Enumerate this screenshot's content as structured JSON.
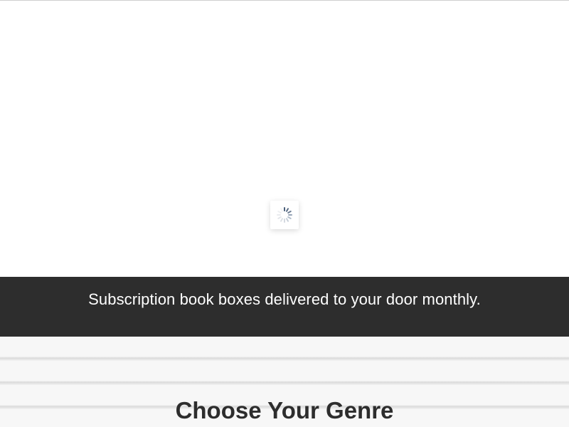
{
  "hero": {
    "loader_icon": "loading-spinner-icon"
  },
  "banner": {
    "tagline": "Subscription book boxes delivered to your door monthly."
  },
  "genre_section": {
    "title": "Choose Your Genre"
  },
  "colors": {
    "banner_background": "#2d2d2d",
    "banner_text": "#ffffff",
    "title_text": "#2d2d2d",
    "spinner_accent": "#4a5f7a"
  }
}
